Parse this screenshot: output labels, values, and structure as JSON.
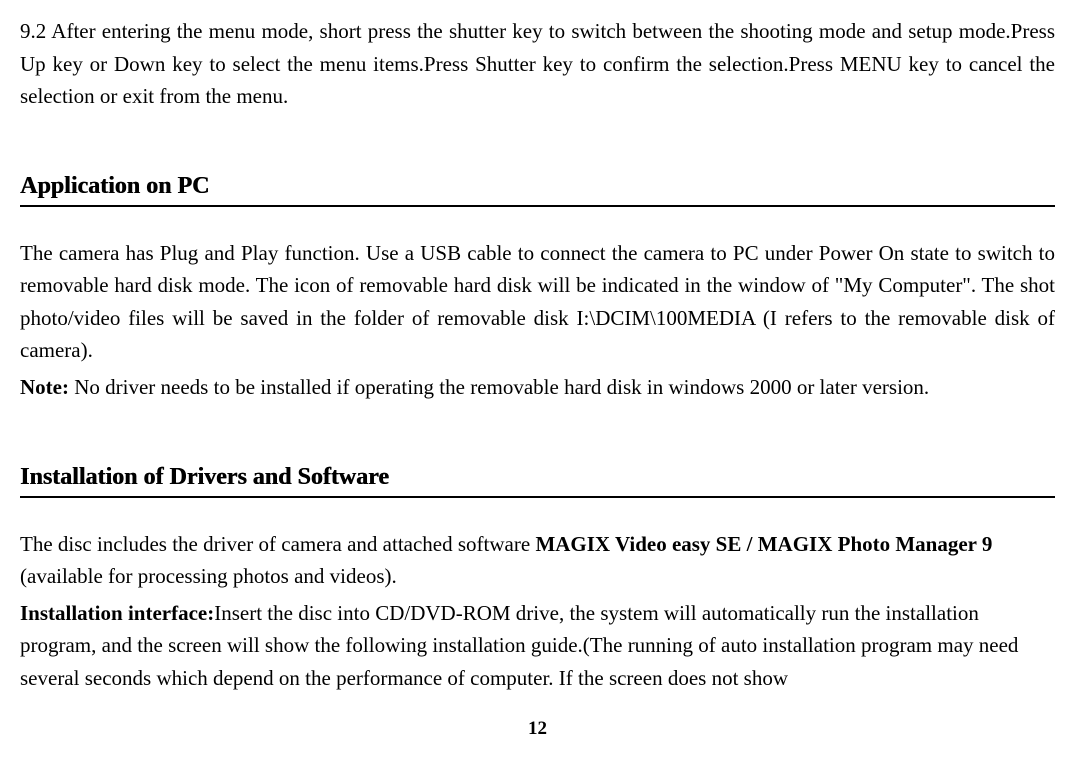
{
  "intro_paragraph": "9.2 After entering the menu mode, short press the shutter key to switch between the shooting mode and setup mode.Press Up key or Down key to select the menu items.Press Shutter key to confirm the selection.Press MENU key to cancel the selection or exit from the menu.",
  "section1": {
    "heading": "Application on PC",
    "p1": "The camera has Plug and Play function. Use a USB cable to connect the camera to PC under Power On state to switch to removable hard disk mode. The icon of removable hard disk will be indicated in the window of \"My Computer\". The shot photo/video files will be saved in the folder of removable disk I:\\DCIM\\100MEDIA (I refers to the removable disk of camera).",
    "note_label": "Note:",
    "note_text": " No driver needs to be installed if operating the removable hard disk in windows 2000 or later version."
  },
  "section2": {
    "heading": "Installation of Drivers and Software",
    "p1_prefix": "The disc includes the driver of camera and attached software ",
    "p1_bold": "MAGIX Video easy SE / MAGIX Photo Manager 9",
    "p1_suffix": " (available for processing photos and videos).",
    "p2_label": "Installation interface:",
    "p2_text": "Insert the disc into CD/DVD-ROM drive, the system will automatically run the installation program, and the screen will show the following installation guide.(The running of auto installation program may need several seconds which depend on the performance of computer. If the screen does not show"
  },
  "page_number": "12"
}
